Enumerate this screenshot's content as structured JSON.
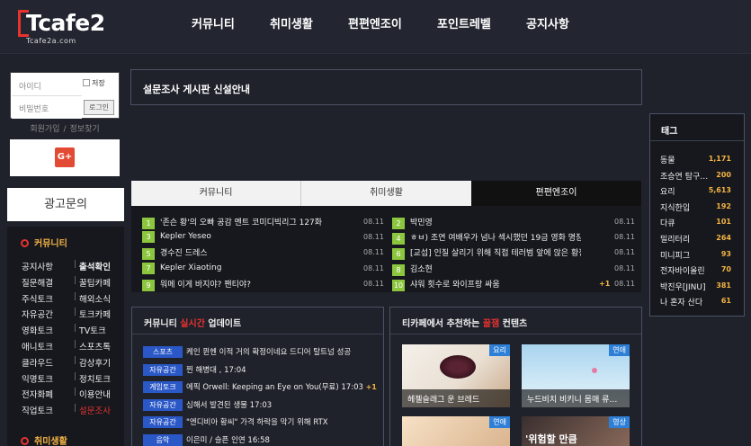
{
  "logo": {
    "name": "Tcafe2",
    "domain": "Tcafe2a.com"
  },
  "nav": [
    "커뮤니티",
    "취미생활",
    "편편엔조이",
    "포인트레벨",
    "공지사항"
  ],
  "login": {
    "id_placeholder": "아이디",
    "pw_placeholder": "비밀번호",
    "save_label": "저장",
    "login_label": "로그인",
    "join": "회원가입",
    "find": "정보찾기",
    "sep": "/",
    "google": "G+"
  },
  "ad": "광고문의",
  "community": {
    "title": "커뮤니티",
    "left": [
      "공지사항",
      "질문해결",
      "주식토크",
      "자유공간",
      "영화토크",
      "애니토크",
      "클라우드",
      "익명토크",
      "전자화폐",
      "직업토크"
    ],
    "right": [
      "출석확인",
      "꿀팁카페",
      "해외소식",
      "토크카페",
      "TV토크",
      "스포츠톡",
      "감상후기",
      "정치토크",
      "이용안내",
      "설문조사"
    ]
  },
  "hobby": {
    "title": "취미생활"
  },
  "notice": "설문조사 게시판 신설안내",
  "board": {
    "tabs": [
      "커뮤니티",
      "취미생활",
      "편편엔조이"
    ],
    "rows": [
      {
        "n": "1",
        "t": "'존슨 황'의 오빠 공감 멘트 코미디빅리그 127화",
        "d": "08.11"
      },
      {
        "n": "2",
        "t": "박민영",
        "d": "08.11"
      },
      {
        "n": "3",
        "t": "Kepler Yeseo",
        "d": "08.11"
      },
      {
        "n": "4",
        "t": "ㅎㅂ) 조연 여배우가 넘나 섹시했던 19금 영화 명장면",
        "d": "08.11"
      },
      {
        "n": "5",
        "t": "경수진 드레스",
        "d": "08.11"
      },
      {
        "n": "6",
        "t": "[교섭] 인질 살리기 위해 직접 테러범 앞에 앉은 황정…",
        "d": "08.11"
      },
      {
        "n": "7",
        "t": "Kepler Xiaoting",
        "d": "08.11"
      },
      {
        "n": "8",
        "t": "김소현",
        "d": "08.11"
      },
      {
        "n": "9",
        "t": "워메 이게 바지야? 팬티야?",
        "d": "08.11"
      },
      {
        "n": "10",
        "t": "샤워 횟수로 와이프랑 싸움",
        "d": "08.11",
        "plus": "+1"
      }
    ]
  },
  "realtime": {
    "title_a": "커뮤니티 ",
    "title_b": "실시간",
    "title_c": " 업데이트",
    "items": [
      {
        "b": "스포츠",
        "t": "케인 뮌헨 이적 거의 확정이네요 드디어 탈트넘 성공"
      },
      {
        "b": "자유공간",
        "t": "찐 해병대 , 17:04"
      },
      {
        "b": "게임토크",
        "t": "에픽 Orwell: Keeping an Eye on You(무료) 17:03",
        "plus": "+1"
      },
      {
        "b": "자유공간",
        "t": "심해서 발견된 생물 17:03"
      },
      {
        "b": "자유공간",
        "t": "\"엔디비아 황씨\" 가격 하락을 막기 위해 RTX"
      },
      {
        "b": "음악",
        "t": "이은미 / 슬픈 인연 16:58"
      }
    ]
  },
  "recommend": {
    "title_a": "티카페에서 추천하는 ",
    "title_b": "꿀잼",
    "title_c": " 컨텐츠",
    "items": [
      {
        "label": "요리",
        "caption": "헤젤슬래그 운 브레드"
      },
      {
        "label": "연애",
        "caption": "누드비치 비키니 몸매 류…"
      },
      {
        "label": "연애",
        "caption": ""
      },
      {
        "label": "영상",
        "caption": "'위험할 만큼"
      }
    ]
  },
  "tags": {
    "title": "태그",
    "items": [
      {
        "n": "동물",
        "c": "1,171"
      },
      {
        "n": "조승연 탐구…",
        "c": "200"
      },
      {
        "n": "요리",
        "c": "5,613"
      },
      {
        "n": "지식한입",
        "c": "192"
      },
      {
        "n": "다큐",
        "c": "101"
      },
      {
        "n": "밀리터리",
        "c": "264"
      },
      {
        "n": "미니피그",
        "c": "93"
      },
      {
        "n": "전자바이올린",
        "c": "70"
      },
      {
        "n": "박진우[JINU]",
        "c": "381"
      },
      {
        "n": "나 혼자 산다",
        "c": "61"
      }
    ]
  }
}
